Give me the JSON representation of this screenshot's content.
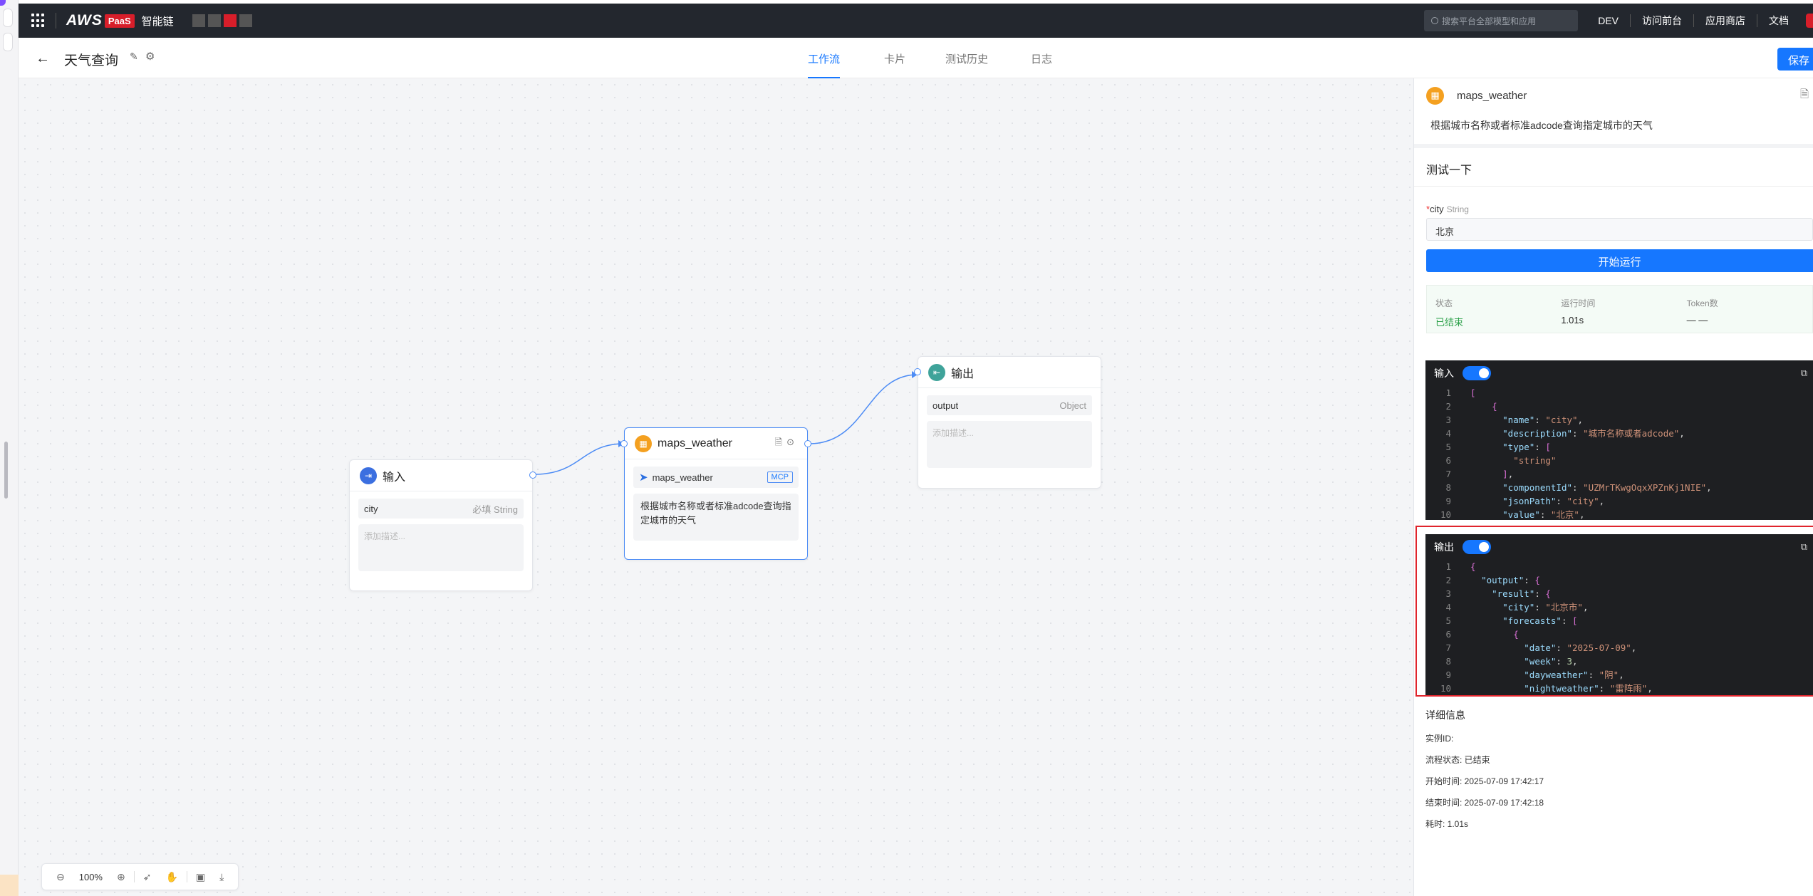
{
  "topbar": {
    "brand_main": "AWS",
    "brand_badge": "PaaS",
    "brand_text": "智能链",
    "search_placeholder": "搜索平台全部模型和应用",
    "nav": [
      "DEV",
      "访问前台",
      "应用商店",
      "文档"
    ]
  },
  "header": {
    "title": "天气查询",
    "tabs": [
      "工作流",
      "卡片",
      "测试历史",
      "日志"
    ],
    "active_tab": "工作流",
    "save_label": "保存"
  },
  "nodes": {
    "input": {
      "title": "输入",
      "param_name": "city",
      "param_type": "必填 String",
      "desc_placeholder": "添加描述..."
    },
    "weather": {
      "title": "maps_weather",
      "tool_name": "maps_weather",
      "tool_badge": "MCP",
      "desc": "根据城市名称或者标准adcode查询指定城市的天气"
    },
    "output": {
      "title": "输出",
      "param_name": "output",
      "param_type": "Object",
      "desc_placeholder": "添加描述..."
    }
  },
  "zoombar": {
    "zoom": "100%"
  },
  "panel": {
    "title": "maps_weather",
    "desc": "根据城市名称或者标准adcode查询指定城市的天气",
    "test_title": "测试一下",
    "field_required": "*",
    "field_name": "city",
    "field_type": "String",
    "field_value": "北京",
    "run_label": "开始运行",
    "stats": {
      "status_label": "状态",
      "status_value": "已结束",
      "time_label": "运行时间",
      "time_value": "1.01s",
      "token_label": "Token数",
      "token_value": "— —"
    },
    "input_label": "输入",
    "output_label": "输出",
    "details": {
      "title": "详细信息",
      "instance": "实例ID:",
      "flow_status": "流程状态: 已结束",
      "start": "开始时间: 2025-07-09 17:42:17",
      "end": "结束时间: 2025-07-09 17:42:18",
      "cost": "耗时: 1.01s"
    }
  },
  "code_input_lines": [
    "[",
    "    {",
    "      \"name\": \"city\",",
    "      \"description\": \"城市名称或者adcode\",",
    "      \"type\": [",
    "        \"string\"",
    "      ],",
    "      \"componentId\": \"UZMrTKwgOqxXPZnKj1NIE\",",
    "      \"jsonPath\": \"city\",",
    "      \"value\": \"北京\","
  ],
  "code_output_lines": [
    "{",
    "  \"output\": {",
    "    \"result\": {",
    "      \"city\": \"北京市\",",
    "      \"forecasts\": [",
    "        {",
    "          \"date\": \"2025-07-09\",",
    "          \"week\": 3,",
    "          \"dayweather\": \"阴\",",
    "          \"nightweather\": \"雷阵雨\","
  ],
  "colors": {
    "accent": "#1677ff",
    "brand_red": "#d81e2a",
    "highlight": "#e0242c",
    "status_ok": "#2ca14a"
  }
}
